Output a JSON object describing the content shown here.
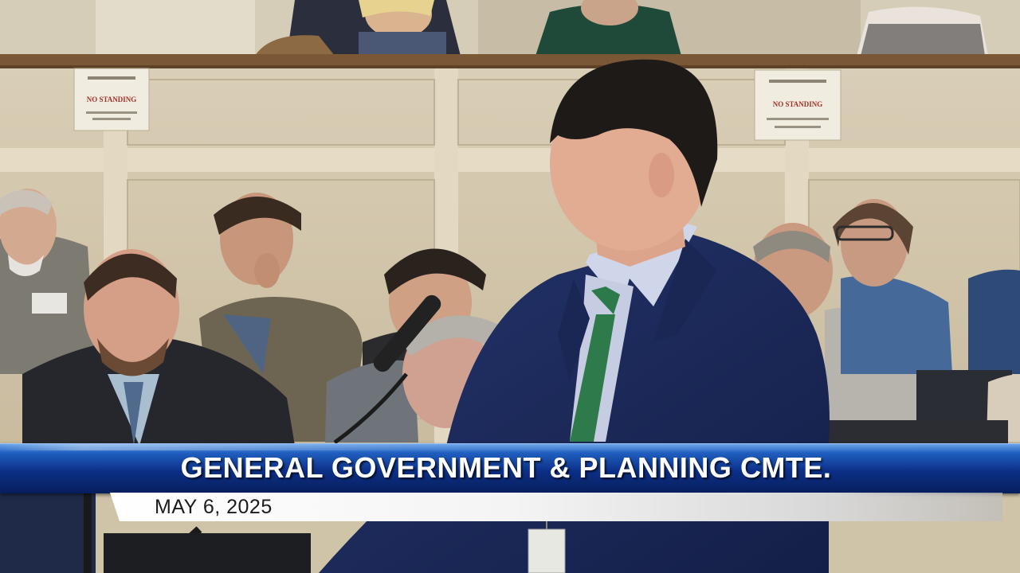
{
  "lower_third": {
    "title": "GENERAL GOVERNMENT & PLANNING CMTE.",
    "date": "MAY 6, 2025"
  },
  "signs": {
    "left_sign_text": "NO STANDING",
    "right_sign_text": "NO STANDING"
  },
  "colors": {
    "banner_blue": "#0c2f86",
    "wall_beige": "#d8ccb2",
    "suit_navy": "#1b2a5c",
    "tie_green": "#2f7a4a"
  }
}
